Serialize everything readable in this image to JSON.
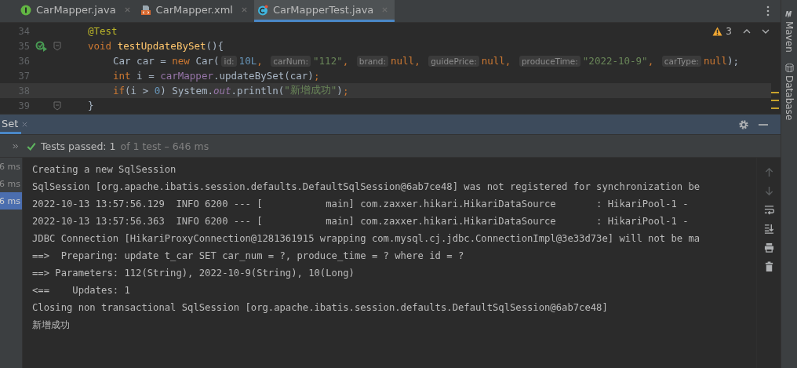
{
  "tabs": [
    {
      "label": "CarMapper.java",
      "kind": "interface",
      "selected": false
    },
    {
      "label": "CarMapper.xml",
      "kind": "xml",
      "selected": false
    },
    {
      "label": "CarMapperTest.java",
      "kind": "test",
      "selected": true
    }
  ],
  "inspections": {
    "warnings": "3"
  },
  "code_lines": [
    {
      "number": "34",
      "current": false,
      "tokens": [
        {
          "kind": "annotation",
          "t": "@Test"
        }
      ]
    },
    {
      "number": "35",
      "current": false,
      "run_gutter": true,
      "fold": true,
      "tokens": [
        {
          "kind": "kw",
          "t": "void "
        },
        {
          "kind": "fn",
          "t": "testUpdateBySet"
        },
        {
          "kind": "plain",
          "t": "(){"
        }
      ],
      "children": [
        {
          "number": "36",
          "current": false,
          "tokens": [
            {
              "kind": "plain",
              "t": "Car car = "
            },
            {
              "kind": "kw",
              "t": "new "
            },
            {
              "kind": "plain",
              "t": "Car("
            },
            {
              "kind": "hint",
              "t": "id:"
            },
            {
              "kind": "num",
              "t": "10L"
            },
            {
              "kind": "kw",
              "t": ", "
            },
            {
              "kind": "hint",
              "t": "carNum:"
            },
            {
              "kind": "str",
              "t": "\"112\""
            },
            {
              "kind": "kw",
              "t": ", "
            },
            {
              "kind": "hint",
              "t": "brand:"
            },
            {
              "kind": "kw",
              "t": "null, "
            },
            {
              "kind": "hint",
              "t": "guidePrice:"
            },
            {
              "kind": "kw",
              "t": "null, "
            },
            {
              "kind": "hint",
              "t": "produceTime:"
            },
            {
              "kind": "str",
              "t": "\"2022-10-9\""
            },
            {
              "kind": "kw",
              "t": ", "
            },
            {
              "kind": "hint",
              "t": "carType:"
            },
            {
              "kind": "kw",
              "t": "null"
            },
            {
              "kind": "plain",
              "t": ");"
            }
          ]
        },
        {
          "number": "37",
          "current": false,
          "tokens": [
            {
              "kind": "kw",
              "t": "int "
            },
            {
              "kind": "plain",
              "t": "i = "
            },
            {
              "kind": "field",
              "t": "carMapper"
            },
            {
              "kind": "plain",
              "t": ".updateBySet(car)"
            },
            {
              "kind": "kw",
              "t": ";"
            }
          ]
        },
        {
          "number": "38",
          "current": true,
          "tokens": [
            {
              "kind": "kw",
              "t": "if"
            },
            {
              "kind": "plain",
              "t": "(i > "
            },
            {
              "kind": "num",
              "t": "0"
            },
            {
              "kind": "plain",
              "t": ") System."
            },
            {
              "kind": "static",
              "t": "out"
            },
            {
              "kind": "plain",
              "t": ".println("
            },
            {
              "kind": "str",
              "t": "\"新增成功\""
            },
            {
              "kind": "plain",
              "t": ")"
            },
            {
              "kind": "kw",
              "t": ";"
            }
          ]
        }
      ]
    },
    {
      "number": "39",
      "current": false,
      "fold": true,
      "tokens": [
        {
          "kind": "plain",
          "t": "}"
        }
      ]
    }
  ],
  "run_panel": {
    "tab": "Set",
    "status": "Tests passed: 1",
    "summary": "of 1 test – 646 ms",
    "durations": [
      {
        "label": "6 ms",
        "selected": false
      },
      {
        "label": "6 ms",
        "selected": false
      },
      {
        "label": "6 ms",
        "selected": true
      }
    ],
    "console": [
      "Creating a new SqlSession",
      "SqlSession [org.apache.ibatis.session.defaults.DefaultSqlSession@6ab7ce48] was not registered for synchronization be",
      "2022-10-13 13:57:56.129  INFO 6200 --- [           main] com.zaxxer.hikari.HikariDataSource       : HikariPool-1 -",
      "2022-10-13 13:57:56.363  INFO 6200 --- [           main] com.zaxxer.hikari.HikariDataSource       : HikariPool-1 -",
      "JDBC Connection [HikariProxyConnection@1281361915 wrapping com.mysql.cj.jdbc.ConnectionImpl@3e33d73e] will not be ma",
      "==>  Preparing: update t_car SET car_num = ?, produce_time = ? where id = ?",
      "==> Parameters: 112(String), 2022-10-9(String), 10(Long)",
      "<==    Updates: 1",
      "Closing non transactional SqlSession [org.apache.ibatis.session.defaults.DefaultSqlSession@6ab7ce48]",
      "新增成功"
    ]
  },
  "right_stripe": [
    "Maven",
    "Database"
  ]
}
